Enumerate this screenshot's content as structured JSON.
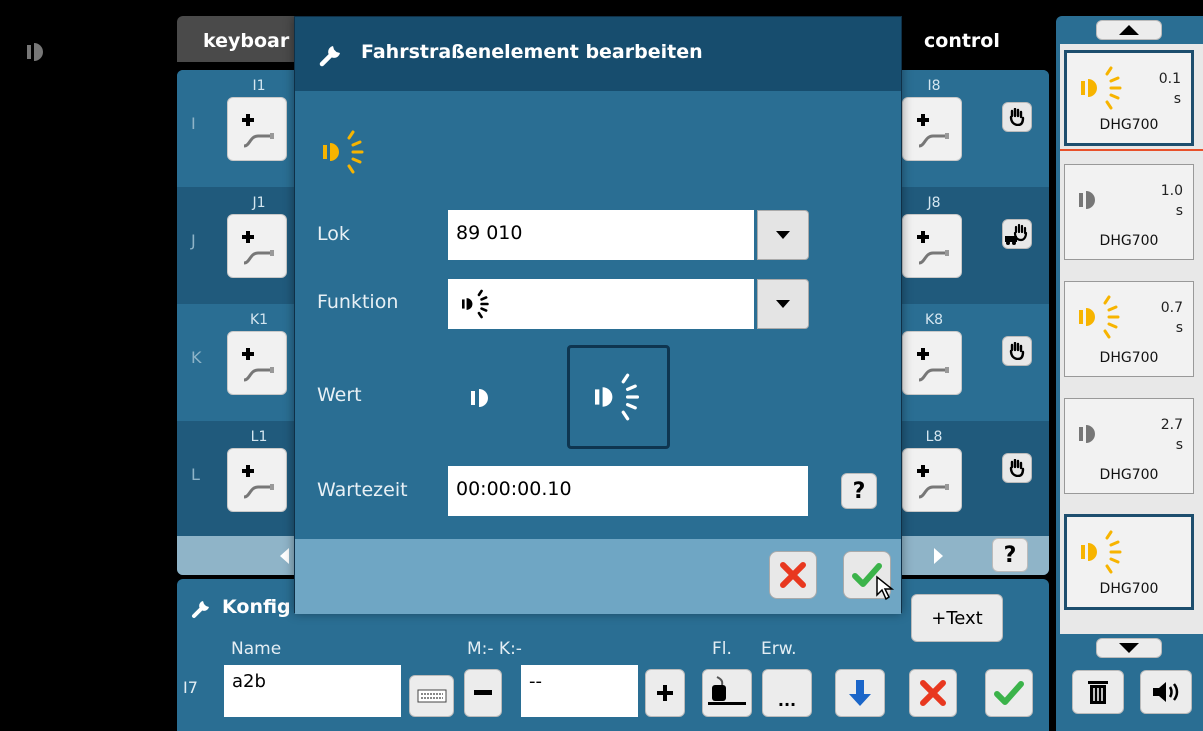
{
  "header": {
    "keyboard_tab": "keyboar",
    "control_tab": "control",
    "status_icon": "lamp-off-icon"
  },
  "keyboard": {
    "rows": [
      {
        "letter": "I",
        "left_label": "I1",
        "right_label": "I8",
        "right_icon": "hand-icon"
      },
      {
        "letter": "J",
        "left_label": "J1",
        "right_label": "J8",
        "right_icon": "hand-train-icon"
      },
      {
        "letter": "K",
        "left_label": "K1",
        "right_label": "K8",
        "right_icon": "hand-icon"
      },
      {
        "letter": "L",
        "left_label": "L1",
        "right_label": "L8",
        "right_icon": "hand-icon"
      }
    ],
    "footer_help": "?"
  },
  "config": {
    "title": "Konfig",
    "name_label": "Name",
    "mk_label": "M:- K:-",
    "fl_label": "Fl.",
    "erw_label": "Erw.",
    "row_label": "I7",
    "name_value": "a2b",
    "address_value": "--",
    "erw_button": "...",
    "text_button": "+Text"
  },
  "dialog": {
    "title": "Fahrstraßenelement bearbeiten",
    "lok_label": "Lok",
    "lok_value": "89 010",
    "funktion_label": "Funktion",
    "wert_label": "Wert",
    "wartezeit_label": "Wartezeit",
    "wartezeit_value": "00:00:00.10",
    "help": "?"
  },
  "right_list": {
    "items": [
      {
        "state": "on",
        "time": "0.1",
        "unit": "s",
        "name": "DHG700",
        "selected": true
      },
      {
        "state": "off",
        "time": "1.0",
        "unit": "s",
        "name": "DHG700",
        "selected": false
      },
      {
        "state": "on",
        "time": "0.7",
        "unit": "s",
        "name": "DHG700",
        "selected": false
      },
      {
        "state": "off",
        "time": "2.7",
        "unit": "s",
        "name": "DHG700",
        "selected": false
      },
      {
        "state": "on",
        "time": "",
        "unit": "",
        "name": "DHG700",
        "selected": true
      }
    ]
  },
  "colors": {
    "panel": "#2a6e93",
    "header": "#174d6e",
    "accent_lamp": "#f7b400",
    "confirm": "#3bb34a",
    "cancel": "#e8381f",
    "arrow_blue": "#1b66c9"
  }
}
